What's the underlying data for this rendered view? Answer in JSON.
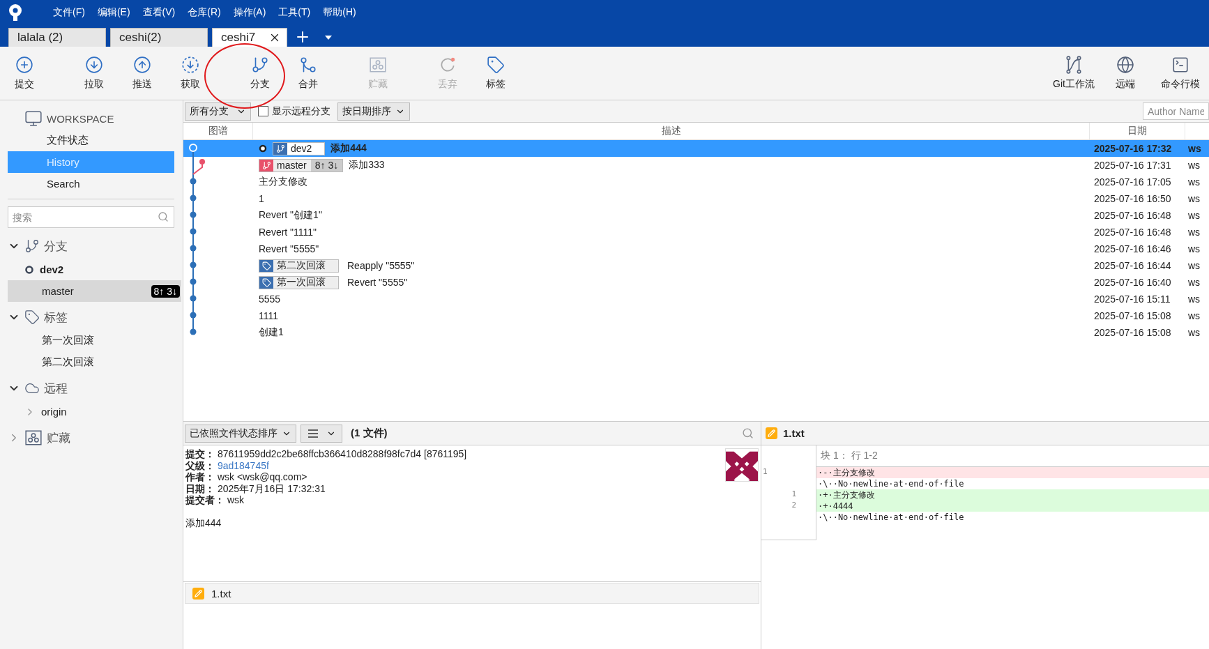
{
  "menu": [
    "文件(F)",
    "编辑(E)",
    "查看(V)",
    "仓库(R)",
    "操作(A)",
    "工具(T)",
    "帮助(H)"
  ],
  "tabs": [
    {
      "label": "lalala (2)",
      "selected": false,
      "closable": false
    },
    {
      "label": "ceshi(2)",
      "selected": false,
      "closable": false
    },
    {
      "label": "ceshi7",
      "selected": true,
      "closable": true
    }
  ],
  "toolbar": {
    "left": [
      {
        "label": "提交",
        "disabled": false
      },
      {
        "label": "拉取",
        "disabled": false
      },
      {
        "label": "推送",
        "disabled": false
      },
      {
        "label": "获取",
        "disabled": false
      },
      {
        "label": "分支",
        "disabled": false
      },
      {
        "label": "合并",
        "disabled": false
      },
      {
        "label": "贮藏",
        "disabled": true
      },
      {
        "label": "丢弃",
        "disabled": true
      },
      {
        "label": "标签",
        "disabled": false
      }
    ],
    "right": [
      {
        "label": "Git工作流",
        "disabled": false
      },
      {
        "label": "远端",
        "disabled": false
      },
      {
        "label": "命令行模",
        "disabled": false
      }
    ]
  },
  "sidebar": {
    "workspace": {
      "title": "WORKSPACE",
      "items": [
        {
          "label": "文件状态",
          "selected": false
        },
        {
          "label": "History",
          "selected": true
        },
        {
          "label": "Search",
          "selected": false
        }
      ]
    },
    "search": {
      "placeholder": "搜索"
    },
    "sections": [
      {
        "title": "分支",
        "expanded": true,
        "children": [
          {
            "label": "dev2",
            "current": true,
            "selected": false
          },
          {
            "label": "master",
            "current": false,
            "selected": true,
            "badge": "8↑ 3↓"
          }
        ]
      },
      {
        "title": "标签",
        "expanded": true,
        "children": [
          {
            "label": "第一次回滚"
          },
          {
            "label": "第二次回滚"
          }
        ]
      },
      {
        "title": "远程",
        "expanded": true,
        "children": [
          {
            "label": "origin",
            "expanded": false
          }
        ]
      },
      {
        "title": "贮藏",
        "expanded": false
      }
    ]
  },
  "filter": {
    "branches": "所有分支",
    "show_remote": {
      "label": "显示远程分支",
      "checked": false
    },
    "sort": "按日期排序",
    "author": {
      "placeholder": "Author Name"
    }
  },
  "commits": {
    "columns": [
      "图谱",
      "描述",
      "日期"
    ],
    "rows": [
      {
        "selected": true,
        "refs": [
          {
            "kind": "branch",
            "name": "dev2",
            "current": true
          }
        ],
        "description": "添加444",
        "date": "2025-07-16 17:32",
        "column_4": "ws"
      },
      {
        "selected": false,
        "refs": [
          {
            "kind": "branch",
            "name": "master",
            "current": false,
            "ahead_behind": "8↑ 3↓"
          }
        ],
        "description": "添加333",
        "date": "2025-07-16 17:31",
        "column_4": "ws"
      },
      {
        "selected": false,
        "refs": [],
        "description": "主分支修改",
        "date": "2025-07-16 17:05",
        "column_4": "ws"
      },
      {
        "selected": false,
        "refs": [],
        "description": "1",
        "date": "2025-07-16 16:50",
        "column_4": "ws"
      },
      {
        "selected": false,
        "refs": [],
        "description": "Revert \"创建1\"",
        "date": "2025-07-16 16:48",
        "column_4": "ws"
      },
      {
        "selected": false,
        "refs": [],
        "description": "Revert \"1111\"",
        "date": "2025-07-16 16:48",
        "column_4": "ws"
      },
      {
        "selected": false,
        "refs": [],
        "description": "Revert \"5555\"",
        "date": "2025-07-16 16:46",
        "column_4": "ws"
      },
      {
        "selected": false,
        "refs": [
          {
            "kind": "tag",
            "name": "第二次回滚"
          }
        ],
        "description": "Reapply \"5555\"",
        "date": "2025-07-16 16:44",
        "column_4": "ws"
      },
      {
        "selected": false,
        "refs": [
          {
            "kind": "tag",
            "name": "第一次回滚"
          }
        ],
        "description": "Revert \"5555\"",
        "date": "2025-07-16 16:40",
        "column_4": "ws"
      },
      {
        "selected": false,
        "refs": [],
        "description": "5555",
        "date": "2025-07-16 15:11",
        "column_4": "ws"
      },
      {
        "selected": false,
        "refs": [],
        "description": "1111",
        "date": "2025-07-16 15:08",
        "column_4": "ws"
      },
      {
        "selected": false,
        "refs": [],
        "description": "创建1",
        "date": "2025-07-16 15:08",
        "column_4": "ws"
      }
    ]
  },
  "file_toolbar": {
    "sort": "已依照文件状态排序",
    "count": "(1 文件)"
  },
  "details": [
    {
      "label": "提交：",
      "value": "87611959dd2c2be68ffcb366410d8288f98fc7d4 [8761195]",
      "link": false
    },
    {
      "label": "父级：",
      "value": "9ad184745f",
      "link": true
    },
    {
      "label": "作者：",
      "value": "wsk <wsk@qq.com>",
      "link": false
    },
    {
      "label": "日期：",
      "value": "2025年7月16日 17:32:31",
      "link": false
    },
    {
      "label": "提交者：",
      "value": "wsk",
      "link": false
    }
  ],
  "message": "添加444",
  "files": [
    {
      "name": "1.txt"
    }
  ],
  "diff": {
    "file": "1.txt",
    "hunk": "块 1： 行 1-2",
    "lines": [
      {
        "kind": "removed",
        "old": "1",
        "text": "·-·主分支修改"
      },
      {
        "kind": "context",
        "text": "·\\··No·newline·at·end·of·file"
      },
      {
        "kind": "added",
        "new": "1",
        "text": "·+·主分支修改"
      },
      {
        "kind": "added",
        "new": "2",
        "text": "·+·4444"
      },
      {
        "kind": "context",
        "text": "·\\··No·newline·at·end·of·file"
      }
    ]
  }
}
